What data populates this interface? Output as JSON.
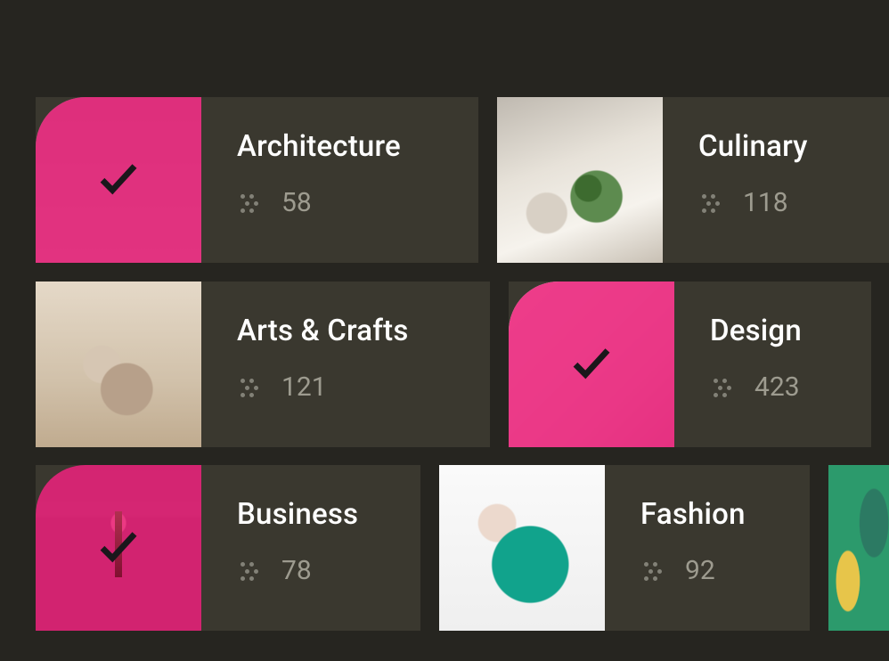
{
  "colors": {
    "bg": "#262520",
    "card_bg": "#3a382f",
    "accent": "#ec247c",
    "text": "#ffffff",
    "muted": "#9d9b8f"
  },
  "rows": [
    {
      "cards": [
        {
          "id": "architecture",
          "title": "Architecture",
          "count": "58",
          "selected": true
        },
        {
          "id": "culinary",
          "title": "Culinary",
          "count": "118",
          "selected": false
        }
      ]
    },
    {
      "cards": [
        {
          "id": "arts",
          "title": "Arts & Crafts",
          "count": "121",
          "selected": false
        },
        {
          "id": "design",
          "title": "Design",
          "count": "423",
          "selected": true
        }
      ]
    },
    {
      "cards": [
        {
          "id": "business",
          "title": "Business",
          "count": "78",
          "selected": true
        },
        {
          "id": "fashion",
          "title": "Fashion",
          "count": "92",
          "selected": false
        }
      ]
    }
  ]
}
